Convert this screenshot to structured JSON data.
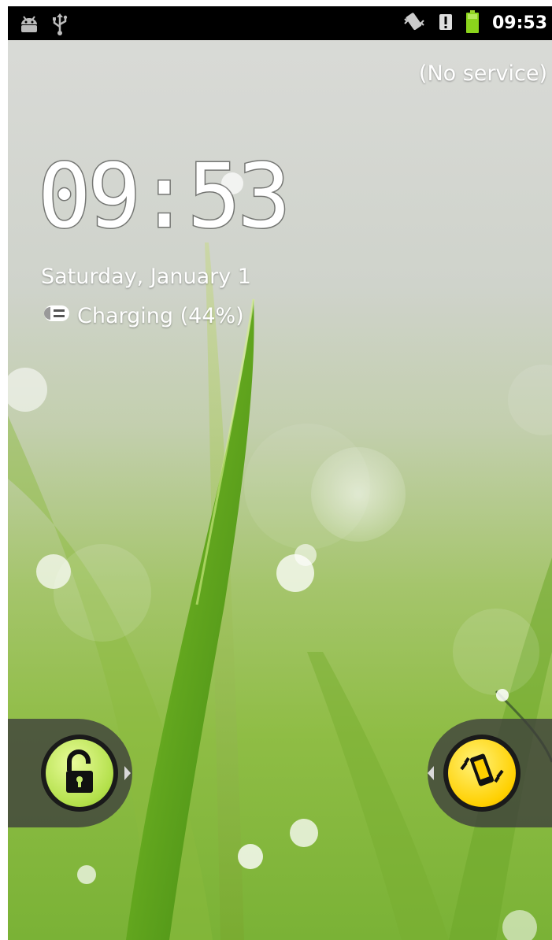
{
  "status_bar": {
    "time": "09:53",
    "icons_left": [
      "android-debug-icon",
      "usb-icon"
    ],
    "icons_right": [
      "vibrate-icon",
      "alert-icon",
      "battery-icon"
    ]
  },
  "lockscreen": {
    "carrier": "(No service)",
    "clock": "09:53",
    "date": "Saturday, January 1",
    "charging": "Charging (44%)"
  },
  "colors": {
    "status_bar_bg": "#000000",
    "unlock_handle": "#c8ec6c",
    "sound_handle": "#ffd000",
    "battery": "#8bd41c"
  }
}
